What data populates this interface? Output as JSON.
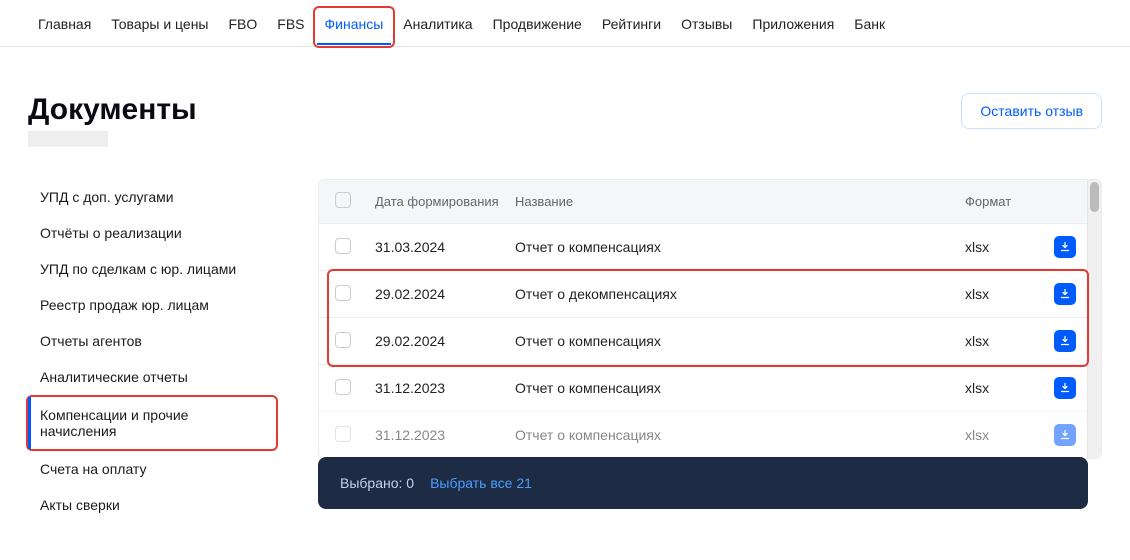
{
  "nav": {
    "items": [
      {
        "label": "Главная",
        "active": false,
        "highlight": false
      },
      {
        "label": "Товары и цены",
        "active": false,
        "highlight": false
      },
      {
        "label": "FBO",
        "active": false,
        "highlight": false
      },
      {
        "label": "FBS",
        "active": false,
        "highlight": false
      },
      {
        "label": "Финансы",
        "active": true,
        "highlight": true
      },
      {
        "label": "Аналитика",
        "active": false,
        "highlight": false
      },
      {
        "label": "Продвижение",
        "active": false,
        "highlight": false
      },
      {
        "label": "Рейтинги",
        "active": false,
        "highlight": false
      },
      {
        "label": "Отзывы",
        "active": false,
        "highlight": false
      },
      {
        "label": "Приложения",
        "active": false,
        "highlight": false
      },
      {
        "label": "Банк",
        "active": false,
        "highlight": false
      }
    ]
  },
  "header": {
    "title": "Документы",
    "feedback_label": "Оставить отзыв"
  },
  "sidebar": {
    "items": [
      {
        "label": "УПД с доп. услугами",
        "active": false,
        "highlight": false
      },
      {
        "label": "Отчёты о реализации",
        "active": false,
        "highlight": false
      },
      {
        "label": "УПД по сделкам с юр. лицами",
        "active": false,
        "highlight": false
      },
      {
        "label": "Реестр продаж юр. лицам",
        "active": false,
        "highlight": false
      },
      {
        "label": "Отчеты агентов",
        "active": false,
        "highlight": false
      },
      {
        "label": "Аналитические отчеты",
        "active": false,
        "highlight": false
      },
      {
        "label": "Компенсации и прочие начисления",
        "active": true,
        "highlight": true
      },
      {
        "label": "Счета на оплату",
        "active": false,
        "highlight": false
      },
      {
        "label": "Акты сверки",
        "active": false,
        "highlight": false
      }
    ]
  },
  "table": {
    "columns": {
      "date": "Дата формирования",
      "name": "Название",
      "format": "Формат"
    },
    "rows": [
      {
        "date": "31.03.2024",
        "name": "Отчет о компенсациях",
        "format": "xlsx"
      },
      {
        "date": "29.02.2024",
        "name": "Отчет о декомпенсациях",
        "format": "xlsx"
      },
      {
        "date": "29.02.2024",
        "name": "Отчет о компенсациях",
        "format": "xlsx"
      },
      {
        "date": "31.12.2023",
        "name": "Отчет о компенсациях",
        "format": "xlsx"
      },
      {
        "date": "31.12.2023",
        "name": "Отчет о компенсациях",
        "format": "xlsx"
      }
    ],
    "highlight_rows": [
      1,
      2
    ]
  },
  "selection_bar": {
    "selected_label": "Выбрано: 0",
    "select_all_label": "Выбрать все 21"
  }
}
